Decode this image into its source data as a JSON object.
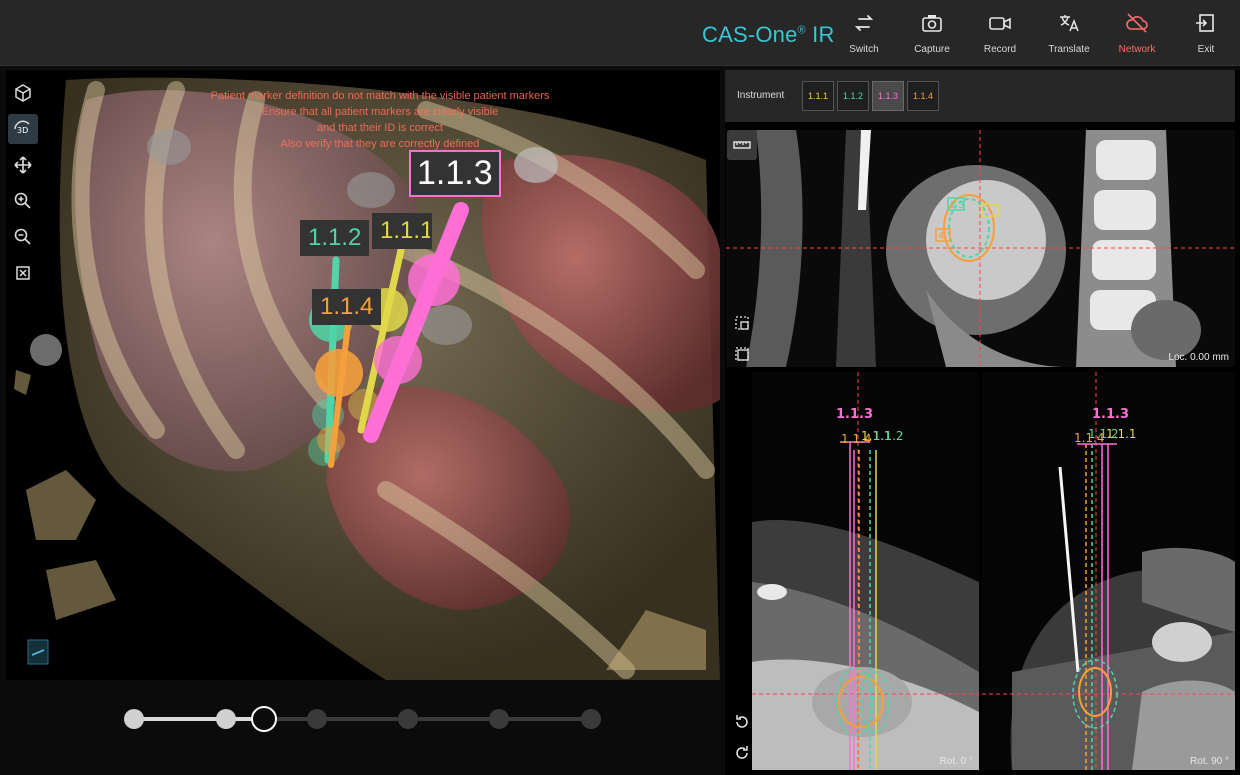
{
  "app": {
    "brand": "CAS-One",
    "brand_mark": "®",
    "brand_suffix": "IR"
  },
  "toolbar": [
    {
      "id": "switch",
      "label": "Switch",
      "icon": "switch-icon"
    },
    {
      "id": "capture",
      "label": "Capture",
      "icon": "camera-icon"
    },
    {
      "id": "record",
      "label": "Record",
      "icon": "video-icon"
    },
    {
      "id": "translate",
      "label": "Translate",
      "icon": "translate-icon"
    },
    {
      "id": "network",
      "label": "Network",
      "icon": "cloud-offline-icon",
      "status_color": "#ff6b6b"
    },
    {
      "id": "exit",
      "label": "Exit",
      "icon": "exit-icon"
    }
  ],
  "view3d": {
    "warning_lines": [
      "Patient marker definition do not match with the visible patient markers",
      "Ensure that all patient markers are clearly visible",
      "and that their ID is correct",
      "Also verify that they are correctly defined"
    ],
    "tags": {
      "t113": "1.1.3",
      "t112": "1.1.2",
      "t111": "1.1.1",
      "t114": "1.1.4"
    }
  },
  "instruments": {
    "label": "Instrument",
    "items": [
      {
        "label": "1.1.1",
        "color": "#e0d84a",
        "selected": false
      },
      {
        "label": "1.1.2",
        "color": "#4fd6a8",
        "selected": false
      },
      {
        "label": "1.1.3",
        "color": "#ff6fd6",
        "selected": true
      },
      {
        "label": "1.1.4",
        "color": "#f4a03c",
        "selected": false
      }
    ]
  },
  "ct": {
    "top": {
      "loc": "Loc. 0.00 mm",
      "marks": {
        "m2": "2",
        "m3": "3",
        "m4": "4",
        "m1": "1"
      }
    },
    "bl": {
      "rot": "Rot. 0 °",
      "head": "1.1.3",
      "sub": "1.1.4",
      "sub2": "1.1.1",
      "sub3": "1.1.2"
    },
    "br": {
      "rot": "Rot. 90 °",
      "head": "1.1.3",
      "sub": "1.1.4",
      "sub2": "1.1.2",
      "sub3": "1.1.1"
    }
  },
  "timeline": {
    "total_steps": 7,
    "current_step": 3
  }
}
